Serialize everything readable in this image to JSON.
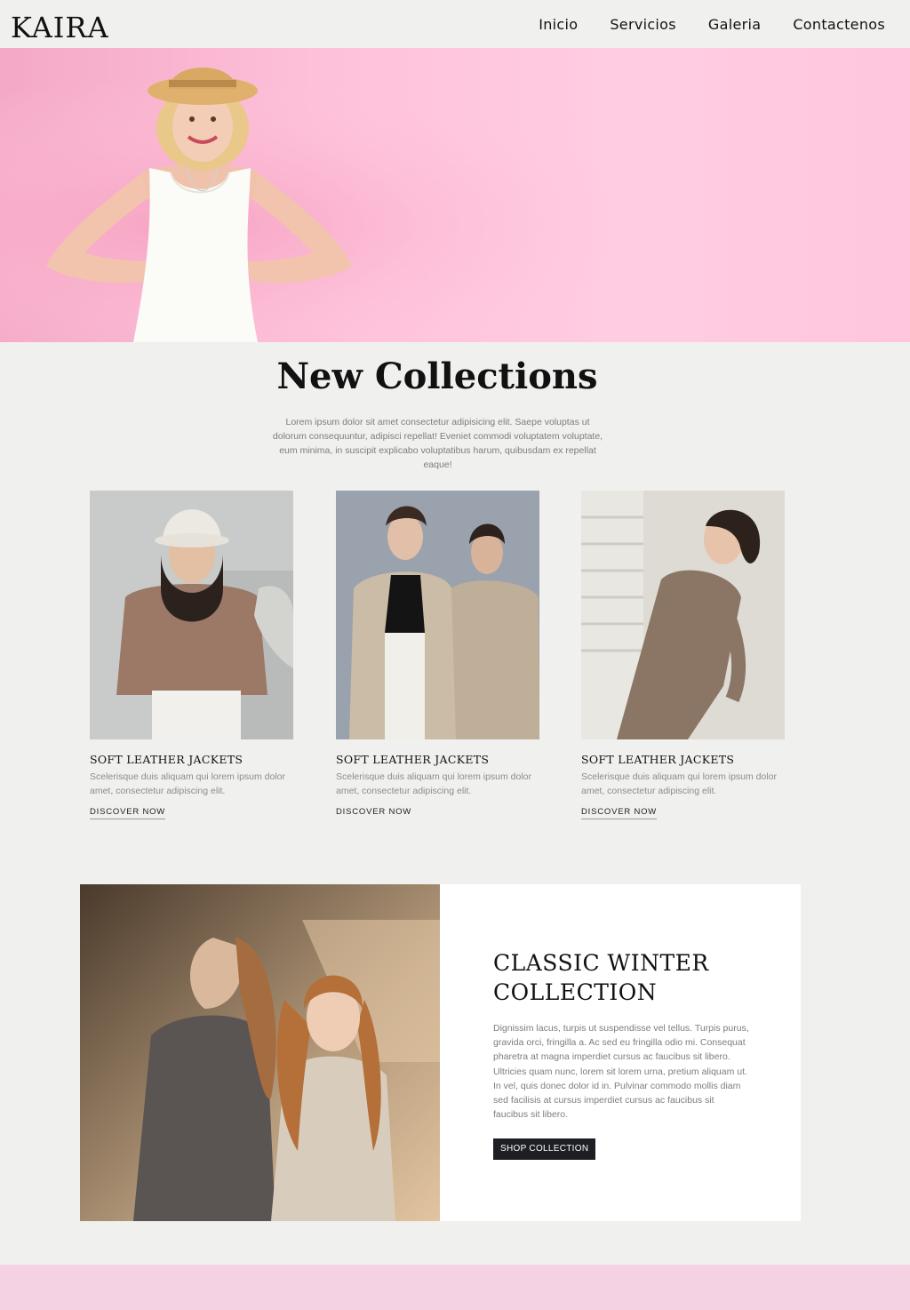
{
  "brand": {
    "logo": "KAIRA"
  },
  "nav": {
    "items": [
      "Inicio",
      "Servicios",
      "Galeria",
      "Contactenos"
    ]
  },
  "hero": {
    "image": "woman-in-straw-hat-pink-background"
  },
  "new_collections": {
    "title": "New Collections",
    "description": "Lorem ipsum dolor sit amet consectetur adipisicing elit. Saepe voluptas ut dolorum consequuntur, adipisci repellat! Eveniet commodi voluptatem voluptate, eum minima, in suscipit explicabo voluptatibus harum, quibusdam ex repellat eaque!",
    "cards": [
      {
        "title": "SOFT LEATHER JACKETS",
        "text": "Scelerisque duis aliquam qui lorem ipsum dolor amet, consectetur adipiscing elit.",
        "link": "DISCOVER NOW"
      },
      {
        "title": "SOFT LEATHER JACKETS",
        "text": "Scelerisque duis aliquam qui lorem ipsum dolor amet, consectetur adipiscing elit.",
        "link": "DISCOVER NOW"
      },
      {
        "title": "SOFT LEATHER JACKETS",
        "text": "Scelerisque duis aliquam qui lorem ipsum dolor amet, consectetur adipiscing elit.",
        "link": "DISCOVER NOW"
      }
    ]
  },
  "winter": {
    "title": "CLASSIC WINTER COLLECTION",
    "text": "Dignissim lacus, turpis ut suspendisse vel tellus. Turpis purus, gravida orci, fringilla a. Ac sed eu fringilla odio mi. Consequat pharetra at magna imperdiet cursus ac faucibus sit libero. Ultricies quam nunc, lorem sit lorem urna, pretium aliquam ut. In vel, quis donec dolor id in. Pulvinar commodo mollis diam sed facilisis at cursus imperdiet cursus ac faucibus sit faucibus sit libero.",
    "button": "SHOP COLLECTION"
  },
  "colors": {
    "page_bg": "#f0f0ee",
    "hero_pink": "#ffc6dd",
    "footer_pink": "#f5d2e3",
    "button_dark": "#1e1f25"
  }
}
